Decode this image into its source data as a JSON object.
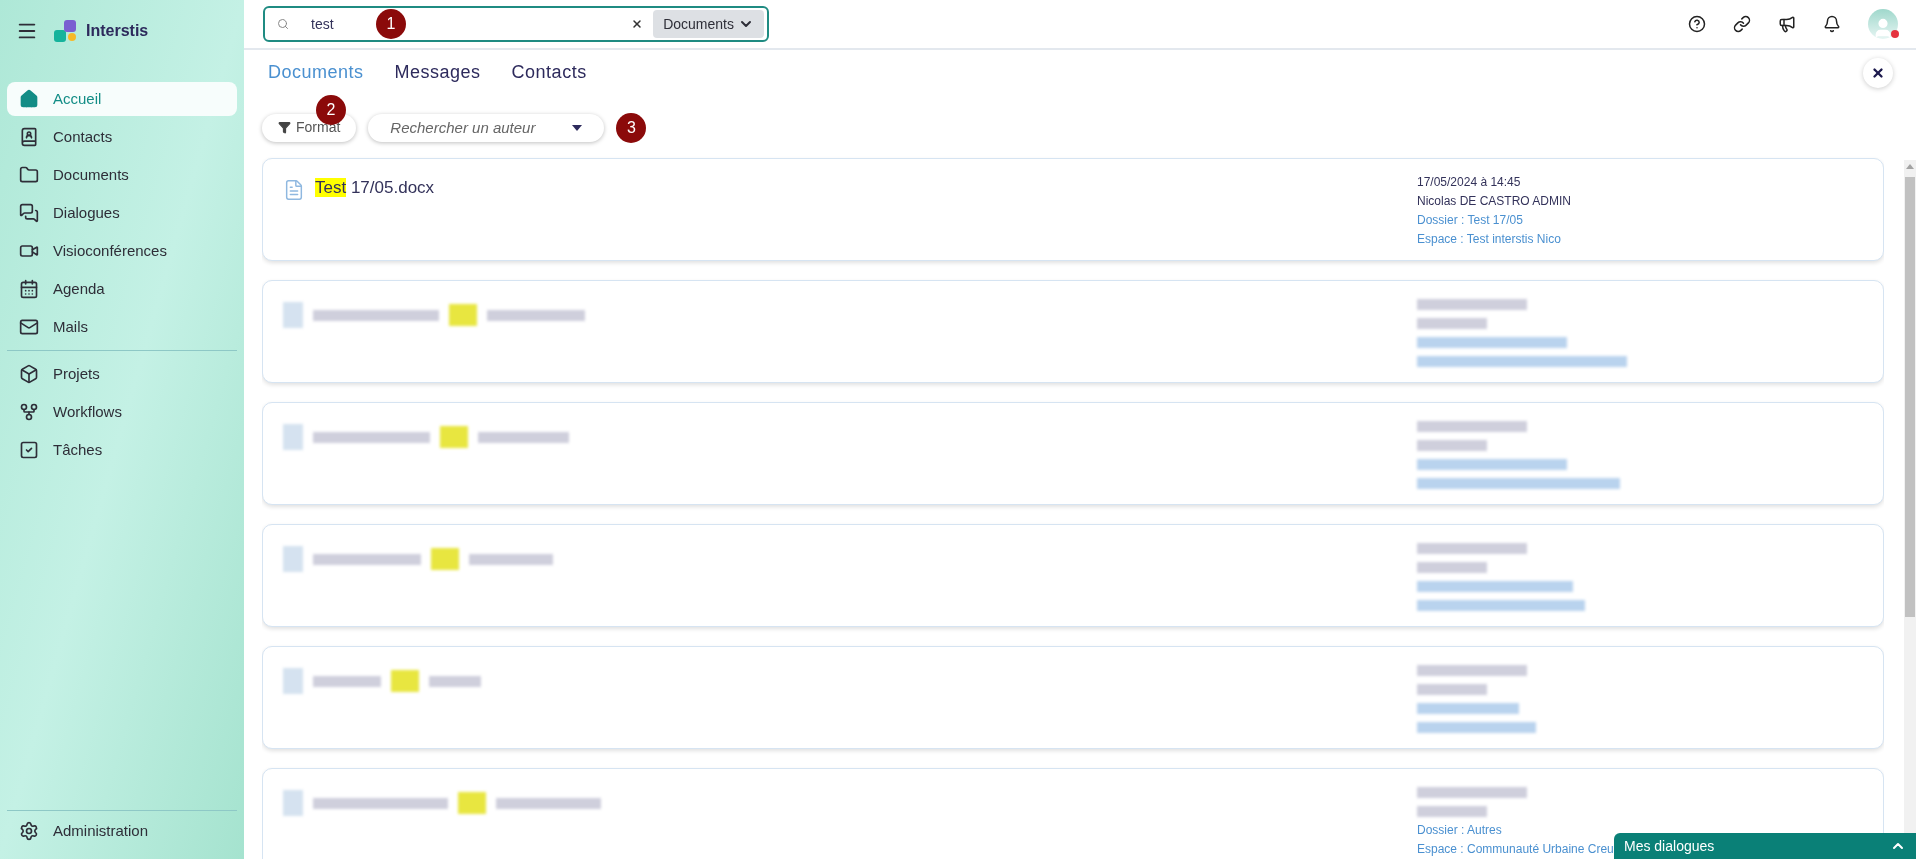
{
  "app": {
    "name": "Interstis"
  },
  "sidebar": {
    "items": [
      {
        "label": "Accueil",
        "selected": true
      },
      {
        "label": "Contacts",
        "selected": false
      },
      {
        "label": "Documents",
        "selected": false
      },
      {
        "label": "Dialogues",
        "selected": false
      },
      {
        "label": "Visioconférences",
        "selected": false
      },
      {
        "label": "Agenda",
        "selected": false
      },
      {
        "label": "Mails",
        "selected": false
      },
      {
        "label": "Projets",
        "selected": false
      },
      {
        "label": "Workflows",
        "selected": false
      },
      {
        "label": "Tâches",
        "selected": false
      }
    ],
    "footer": {
      "label": "Administration"
    }
  },
  "search": {
    "value": "test",
    "scope": "Documents"
  },
  "tabs": [
    {
      "label": "Documents",
      "selected": true
    },
    {
      "label": "Messages",
      "selected": false
    },
    {
      "label": "Contacts",
      "selected": false
    }
  ],
  "filters": {
    "format": "Format",
    "author_placeholder": "Rechercher un auteur"
  },
  "annotations": [
    "1",
    "2",
    "3"
  ],
  "results": [
    {
      "kind": "readable",
      "match": "Test",
      "title": " 17/05.docx",
      "date": "17/05/2024 à 14:45",
      "author": "Nicolas DE CASTRO ADMIN",
      "folder": "Dossier : Test 17/05",
      "space": "Espace : Test interstis Nico"
    },
    {
      "kind": "blurred"
    },
    {
      "kind": "blurred"
    },
    {
      "kind": "blurred"
    },
    {
      "kind": "blurred"
    },
    {
      "kind": "blurred",
      "folder": "Dossier : Autres",
      "space": "Espace : Communauté Urbaine Creu"
    }
  ],
  "dialogs_panel": {
    "title": "Mes dialogues"
  }
}
